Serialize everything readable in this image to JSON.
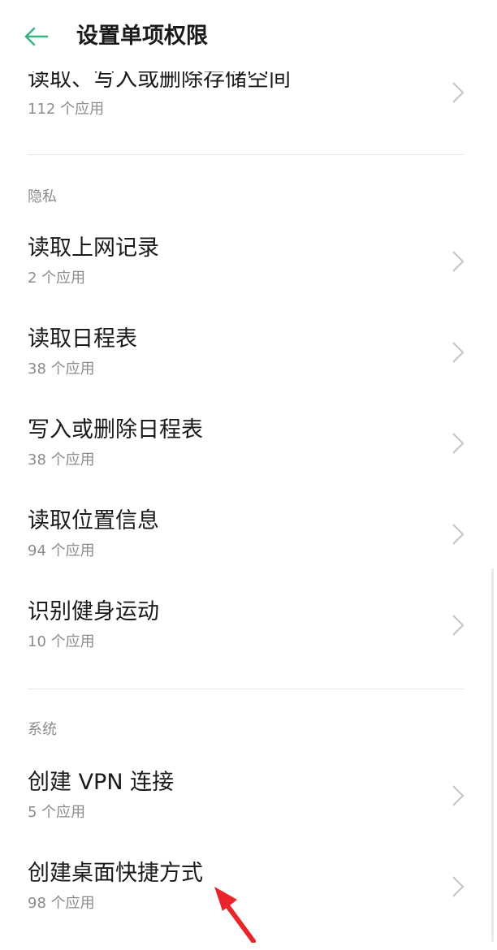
{
  "header": {
    "title": "设置单项权限",
    "accent_color": "#37b37e"
  },
  "storage_item": {
    "title": "读取、写入或删除存储空间",
    "subtitle": "112 个应用"
  },
  "privacy_section": {
    "label": "隐私",
    "items": [
      {
        "title": "读取上网记录",
        "subtitle": "2 个应用"
      },
      {
        "title": "读取日程表",
        "subtitle": "38 个应用"
      },
      {
        "title": "写入或删除日程表",
        "subtitle": "38 个应用"
      },
      {
        "title": "读取位置信息",
        "subtitle": "94 个应用"
      },
      {
        "title": "识别健身运动",
        "subtitle": "10 个应用"
      }
    ]
  },
  "system_section": {
    "label": "系统",
    "items": [
      {
        "title": "创建 VPN 连接",
        "subtitle": "5 个应用"
      },
      {
        "title": "创建桌面快捷方式",
        "subtitle": "98 个应用"
      }
    ]
  },
  "annotation": {
    "arrow_color": "#e8262a"
  }
}
